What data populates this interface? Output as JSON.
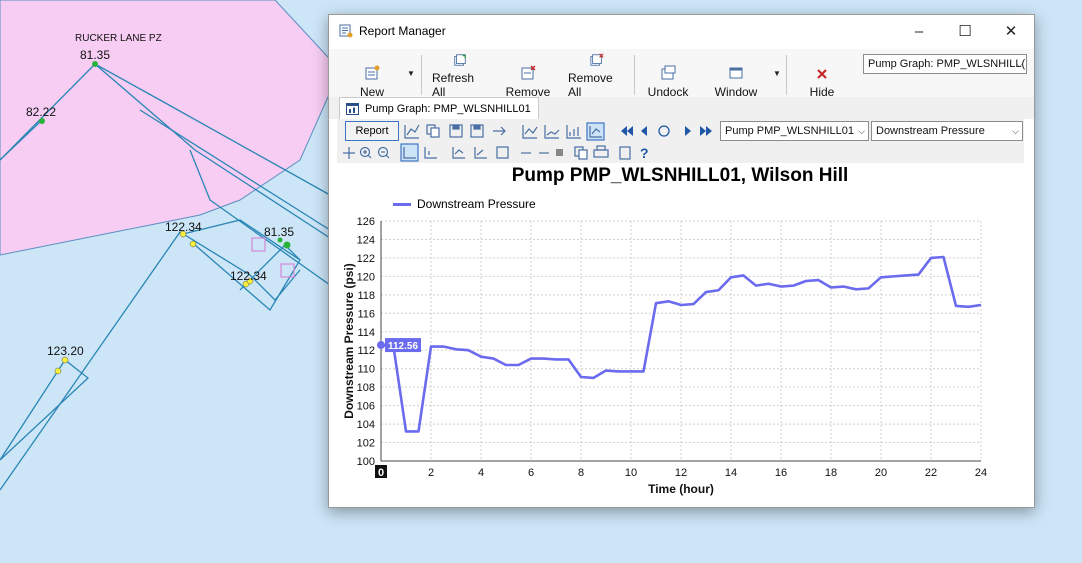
{
  "map": {
    "labels": [
      {
        "id": "zone",
        "text": "RUCKER LANE PZ"
      },
      {
        "id": "n1",
        "text": "81.35"
      },
      {
        "id": "n2",
        "text": "82.22"
      },
      {
        "id": "n3",
        "text": "122.34"
      },
      {
        "id": "n4",
        "text": "81.35"
      },
      {
        "id": "n5",
        "text": "122.34"
      },
      {
        "id": "n6",
        "text": "123.20"
      }
    ],
    "colors": {
      "background": "#cce5f7",
      "zone": "#f7cdf3",
      "pipe": "#2a86b5",
      "node_yellow": "#f6f03a",
      "node_green": "#29b33b",
      "marker": "#d28ad8"
    }
  },
  "window": {
    "title": "Report Manager",
    "icon": "report-manager-icon",
    "controls": {
      "minimize": "–",
      "maximize": "☐",
      "close": "✕"
    }
  },
  "toolbar": {
    "buttons": [
      {
        "id": "new",
        "label": "New",
        "icon": "new-report-icon"
      },
      {
        "id": "refresh_all",
        "label": "Refresh All",
        "icon": "refresh-all-icon"
      },
      {
        "id": "remove",
        "label": "Remove",
        "icon": "remove-icon"
      },
      {
        "id": "remove_all",
        "label": "Remove All",
        "icon": "remove-all-icon"
      },
      {
        "id": "undock",
        "label": "Undock",
        "icon": "undock-icon"
      },
      {
        "id": "window",
        "label": "Window",
        "icon": "window-icon"
      },
      {
        "id": "hide",
        "label": "Hide",
        "icon": "hide-icon"
      }
    ],
    "report_select": "Pump Graph: PMP_WLSNHILL("
  },
  "tab": {
    "label": "Pump Graph: PMP_WLSNHILL01",
    "icon": "graph-icon"
  },
  "graph_toolbar": {
    "report_button": "Report",
    "element_select": "Pump PMP_WLSNHILL01",
    "attribute_select": "Downstream Pressure"
  },
  "accent": "#3f75c4",
  "series_color": "#6b6bef",
  "chart_data": {
    "type": "line",
    "title": "Pump PMP_WLSNHILL01, Wilson Hill",
    "xlabel": "Time (hour)",
    "ylabel": "Downstream Pressure (psi)",
    "xlim": [
      0,
      24
    ],
    "ylim": [
      100,
      126
    ],
    "xticks": [
      0,
      2,
      4,
      6,
      8,
      10,
      12,
      14,
      16,
      18,
      20,
      22,
      24
    ],
    "yticks": [
      100,
      102,
      104,
      106,
      108,
      110,
      112,
      114,
      116,
      118,
      120,
      122,
      124,
      126
    ],
    "grid": true,
    "legend": "top-left",
    "cursor": {
      "x": 0,
      "label": "112.56"
    },
    "series": [
      {
        "name": "Downstream Pressure",
        "x": [
          0,
          0.5,
          1,
          1.5,
          2,
          2.5,
          3,
          3.5,
          4,
          4.5,
          5,
          5.5,
          6,
          6.5,
          7,
          7.5,
          8,
          8.5,
          9,
          9.5,
          10,
          10.5,
          11,
          11.5,
          12,
          12.5,
          13,
          13.5,
          14,
          14.5,
          15,
          15.5,
          16,
          16.5,
          17,
          17.5,
          18,
          18.5,
          19,
          19.5,
          20,
          20.5,
          21,
          21.5,
          22,
          22.5,
          23,
          23.5,
          24
        ],
        "y": [
          112.56,
          112.4,
          103.2,
          103.2,
          112.4,
          112.4,
          112.1,
          112.0,
          111.3,
          111.1,
          110.4,
          110.4,
          111.1,
          111.1,
          111.0,
          111.0,
          109.1,
          109.0,
          109.8,
          109.7,
          109.7,
          109.7,
          117.1,
          117.3,
          116.9,
          117.0,
          118.3,
          118.5,
          119.9,
          120.1,
          119.0,
          119.2,
          118.9,
          119.0,
          119.5,
          119.6,
          118.8,
          118.9,
          118.6,
          118.7,
          119.9,
          120.0,
          120.1,
          120.2,
          122.0,
          122.1,
          116.8,
          116.7,
          116.9
        ]
      }
    ]
  }
}
